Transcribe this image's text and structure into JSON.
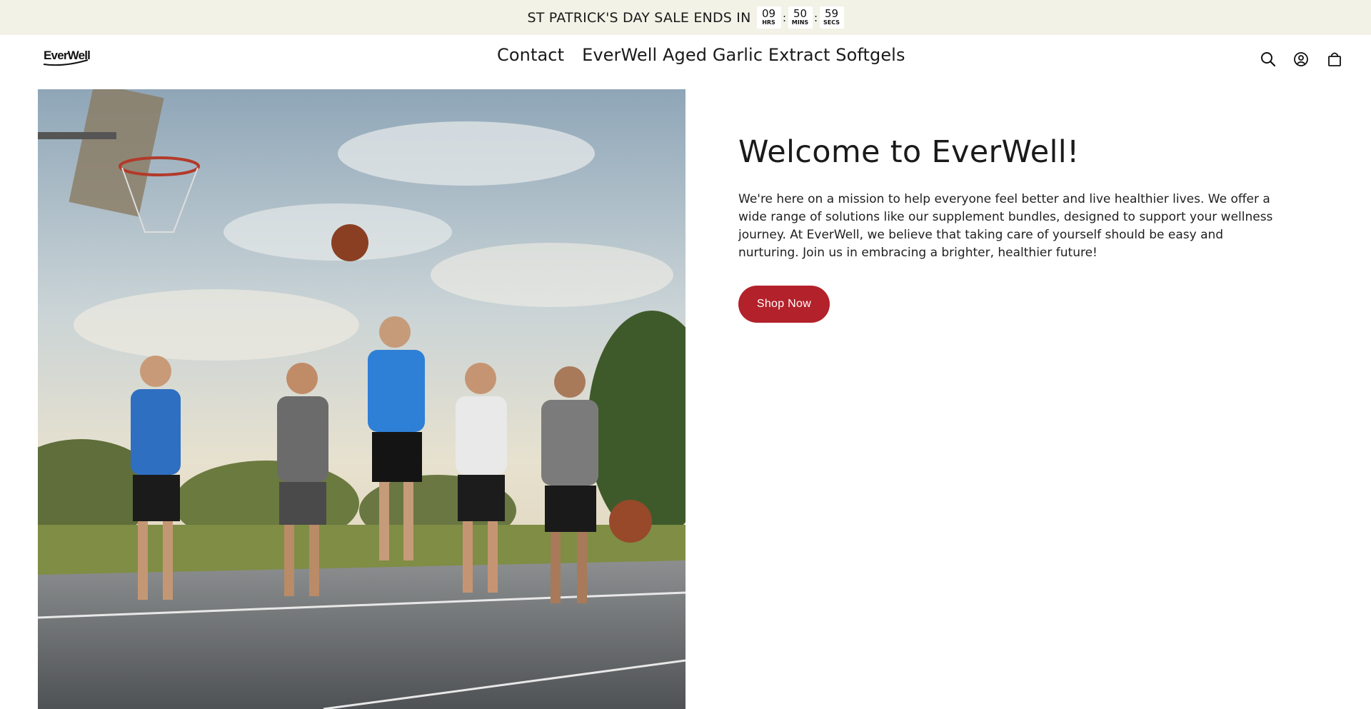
{
  "announcement": {
    "text": "ST PATRICK'S DAY SALE ENDS IN",
    "countdown": [
      {
        "value": "09",
        "label": "HRS"
      },
      {
        "value": "50",
        "label": "MINS"
      },
      {
        "value": "59",
        "label": "SECS"
      }
    ],
    "separator": ":"
  },
  "header": {
    "logo_text": "EverWell",
    "nav": [
      {
        "label": "Contact"
      },
      {
        "label": "EverWell Aged Garlic Extract Softgels"
      }
    ],
    "icons": [
      "search-icon",
      "account-icon",
      "cart-icon"
    ]
  },
  "hero": {
    "image_description": "photo-basketball-court",
    "title": "Welcome to EverWell!",
    "body": "We're here on a mission to help everyone feel better and live healthier lives. We offer a wide range of solutions like our supplement bundles, designed to support your wellness journey. At EverWell, we believe that taking care of yourself should be easy and nurturing. Join us in embracing a brighter, healthier future!",
    "button_label": "Shop Now"
  },
  "colors": {
    "announcement_bg": "#f3f2e7",
    "button_bg": "#b3212a",
    "text": "#1a1a1a"
  }
}
